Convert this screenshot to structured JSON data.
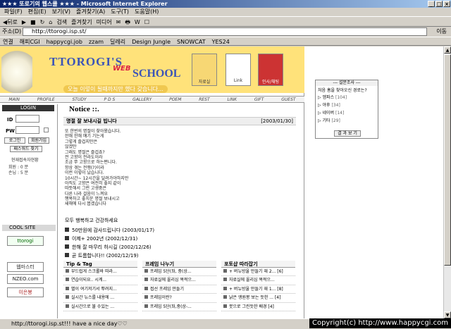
{
  "window": {
    "title": "★★★ 또로기의 웹스쿨 ★★★ - Microsoft Internet Explorer",
    "buttons": [
      "_",
      "□",
      "×"
    ]
  },
  "menu": [
    "파일(F)",
    "편집(E)",
    "보기(V)",
    "즐겨찾기(A)",
    "도구(T)",
    "도움말(H)"
  ],
  "toolbar": [
    "◀뒤로",
    "▶",
    "■",
    "↻",
    "⌂",
    "검색",
    "즐겨찾기",
    "미디어",
    "✉",
    "🖶",
    "W",
    "☐"
  ],
  "address": {
    "label": "주소(D)",
    "url": "http://ttorogi.isp.st/",
    "go": "이동"
  },
  "links": {
    "label": "연결",
    "items": [
      "해피CGI",
      "happycgi.job",
      "zzam",
      "딜레리",
      "Design Jungle",
      "SNOWCAT",
      "YES24"
    ]
  },
  "header": {
    "logo": "TTOROGI'S",
    "logo_web": "WEB",
    "logo_school": "SCHOOL",
    "slogan": "오늘 이렇이 될때까지만 했다 갖습니다...",
    "icons": [
      "자료실",
      "Link",
      "인사/채팅"
    ]
  },
  "nav": [
    "MAIN",
    "PROFILE",
    "STUDY",
    "P D S",
    "GALLERY",
    "POEM",
    "REST",
    "LINK",
    "GIFT",
    "GUEST"
  ],
  "login": {
    "header": "LOGIN",
    "id_label": "ID",
    "pw_label": "PW",
    "buttons": [
      "로그인",
      "회원가입",
      "패스워드 찾기"
    ],
    "stats_title": "현재접속자현황",
    "stats": [
      "회원 : 0 분",
      "손님 : 5 분"
    ]
  },
  "cool_site": {
    "header": "COOL SITE",
    "banners": [
      "ttorogi",
      "웹마스터",
      "NZEO.com",
      "이은봉"
    ]
  },
  "notice": {
    "title": "Notice ::.",
    "post_title": "명절 잘 보내시길 빕니다",
    "post_date": "[2003/01/30]",
    "body": [
      "또 한번의 명절이 찾아왔습니다.",
      "한해 한해 얘기 기는게",
      "그렇게 즐겁지만은",
      "않겠만",
      "그래도 명절은 즐겁죠?",
      "전 고향이 전라도이라",
      "조금 쭈 고향으로 하는편니다.",
      "항상 겪는 전쟁(?)이라",
      "이런 이렇이 났습니다.",
      "10시간~ 12시간을 달려가야하지만",
      "아직도 고향은 여전히 좋지 같이",
      "따뜻해서 그런 고생중은",
      "다른 나라 걸음이 느껴요",
      "행복하고 좋치운 명절 보내시고",
      "새해에 다시 봅겠습니다"
    ],
    "closing": "모두 행복하고 건강하세요",
    "recent": [
      "50만원에 감사드립니다 (2003/01/17)",
      "이제+ 2002년 (2002/12/31)",
      "한해 잘 마무리 하시길 (2002/12/26)",
      "곧 트롬합니다!! (2002/12/19)"
    ]
  },
  "boards": [
    {
      "header": "Tip & Tag",
      "items": [
        "부드럽게 스크롤바 따라...",
        "연습이되요.. 시계...",
        "별이 여기저기서 뿌려지...",
        "실시간 뉴스를 내용에 ...",
        "실시간으로 불 수있는 ..."
      ]
    },
    {
      "header": "프레임 나누기",
      "items": [
        "프레임 5단(좌, 중(상...",
        "자료실에 올리심 목적으...",
        "접선 프레임 만들기",
        "프레임이란?",
        "프레임 5단(좌,중(상-..."
      ]
    },
    {
      "header": "포토샵 따라잡기",
      "items": [
        "+ 버뉴방울 만들기 재 2... [6]",
        "자료실에 올리심 목적으...",
        "+ 버뉴방울 만들기 재 1... [8]",
        "낡은 앵원봉 보는 듯한 ... [4]",
        "붓으로 그린듯한 배경 [4]"
      ]
    }
  ],
  "poll": {
    "header": "--- 설문조사 ---",
    "question": "처음 홈을 찾아오신 경로는?",
    "options": [
      {
        "label": "엠파스",
        "count": "[104]"
      },
      {
        "label": "야후",
        "count": "[34]"
      },
      {
        "label": "네이버",
        "count": "[14]"
      },
      {
        "label": "기타",
        "count": "[29]"
      }
    ],
    "button": "결 과 보 기"
  },
  "status": {
    "text": "http://ttorogi.isp.st!!! have a nice day♡♡",
    "copyright": "Copyright(c) http://www.happycgi.com"
  }
}
